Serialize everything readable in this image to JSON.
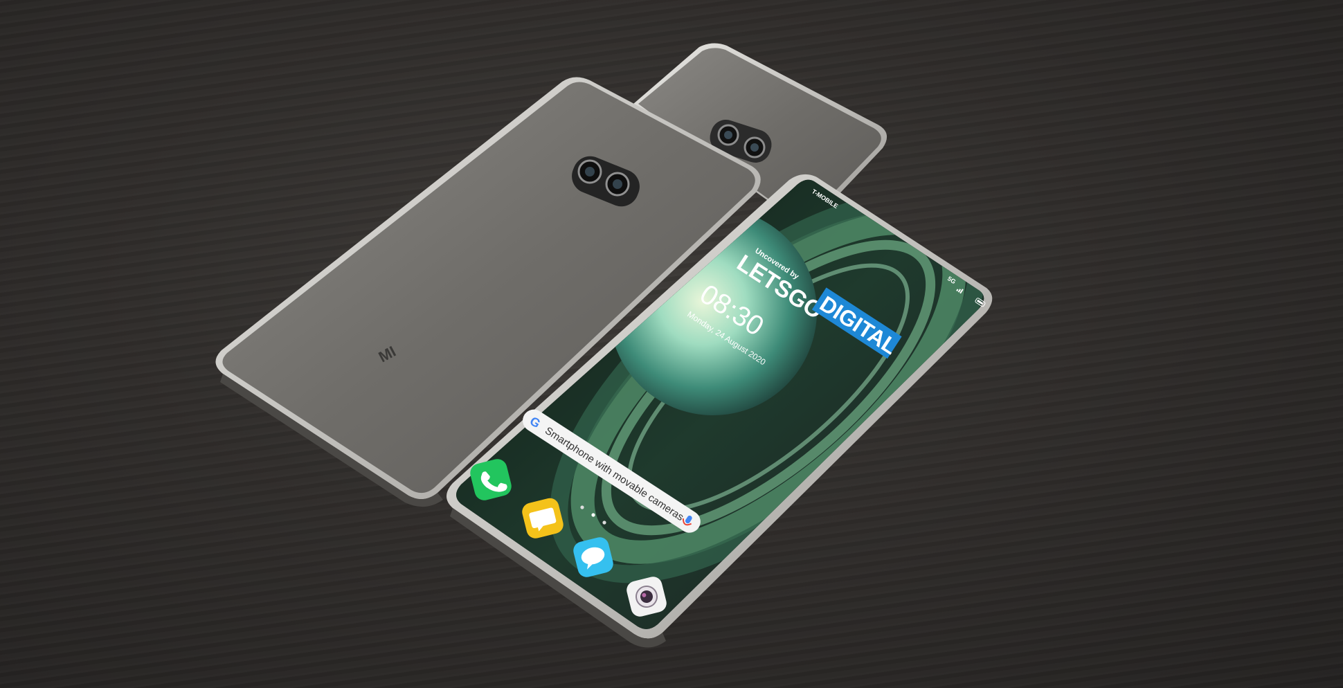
{
  "back_phone": {
    "logo_text": "MI"
  },
  "front_phone": {
    "carrier": "T-MOBILE",
    "network": "5G",
    "watermark_small": "Uncovered by",
    "watermark_big_1": "LETSGO",
    "watermark_big_2": "DIGITAL",
    "clock_time": "08:30",
    "clock_date": "Monday, 24 August 2020",
    "search_placeholder": "Smartphone with movable cameras",
    "google_logo": "G",
    "colors": {
      "wallpaper_ring": "#4f8a66",
      "planet": "#8fd3b0",
      "watermark_bg": "#1e88d6",
      "phone_app": "#22c55e",
      "messages_app": "#f4c21a",
      "chat_app": "#35c0ef"
    },
    "dock_icons": [
      "phone-icon",
      "messages-icon",
      "chat-icon",
      "camera-icon"
    ]
  }
}
